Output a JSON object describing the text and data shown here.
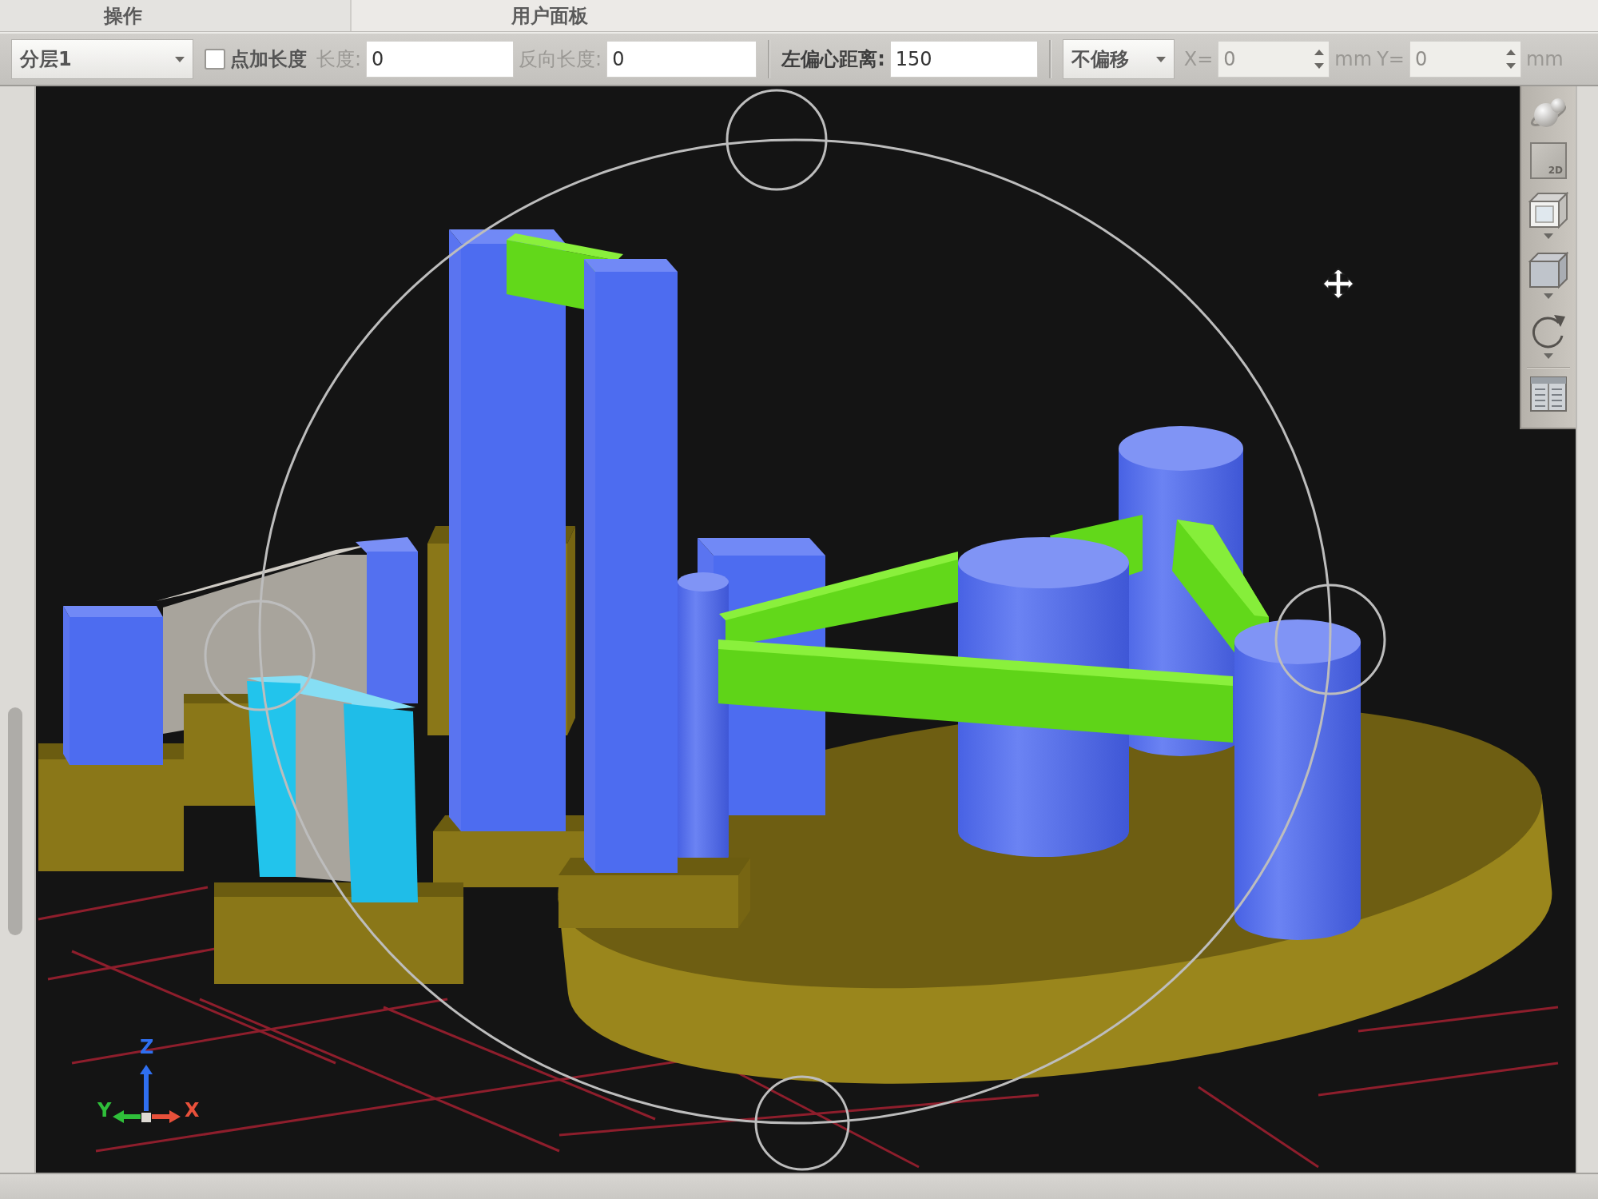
{
  "header": {
    "panels": [
      {
        "title": "操作"
      },
      {
        "title": "用户面板"
      }
    ]
  },
  "toolbar": {
    "layer_select": {
      "value": "分层1"
    },
    "add_length": {
      "label": "点加长度",
      "checked": false
    },
    "fields": [
      {
        "label": "长度:",
        "value": "0",
        "disabled": true
      },
      {
        "label": "反向长度:",
        "value": "0",
        "disabled": true
      },
      {
        "label": "左偏心距离:",
        "value": "150",
        "disabled": false
      }
    ],
    "offset_select": {
      "value": "不偏移"
    },
    "coords": [
      {
        "label": "X=",
        "value": "0",
        "unit": "mm",
        "disabled": true
      },
      {
        "label": "Y=",
        "value": "0",
        "unit": "mm",
        "disabled": true
      }
    ]
  },
  "viewport": {
    "axes": [
      {
        "label": "Y",
        "color": "#2fbf3a"
      },
      {
        "label": "Z",
        "color": "#2f6ff0"
      },
      {
        "label": "X",
        "color": "#e8503a"
      }
    ]
  },
  "view_toolbar": {
    "buttons": [
      {
        "kind": "orbit",
        "has_menu": false
      },
      {
        "kind": "flat",
        "label": "2D",
        "has_menu": false
      },
      {
        "kind": "front",
        "has_menu": true
      },
      {
        "kind": "iso",
        "has_menu": true
      },
      {
        "kind": "rotate",
        "has_menu": true
      },
      {
        "kind": "table",
        "has_menu": false
      }
    ]
  }
}
